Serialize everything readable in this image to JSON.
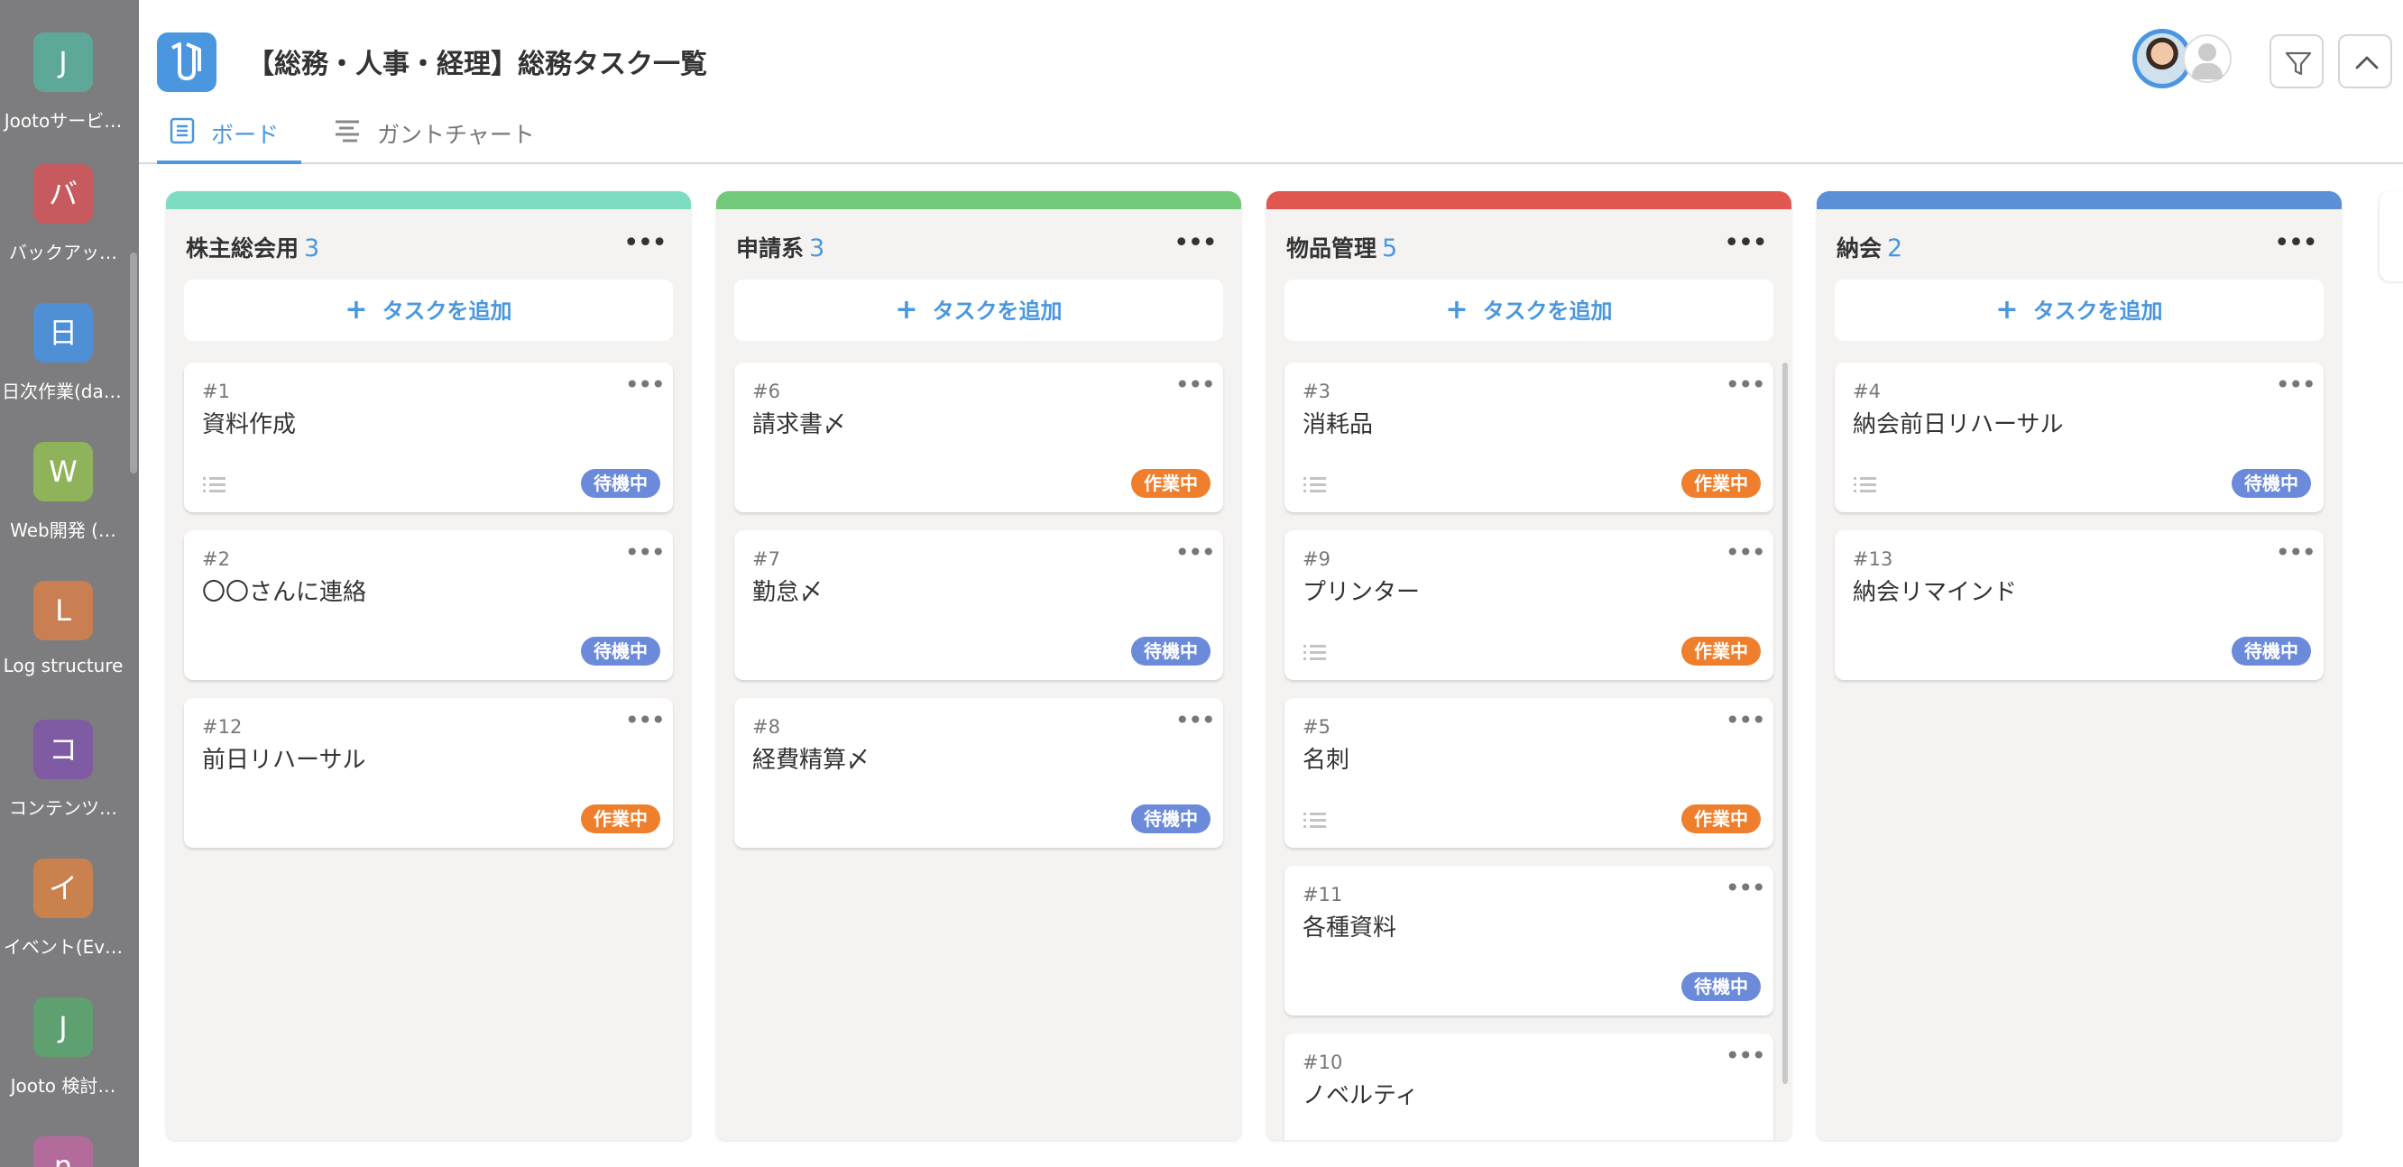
{
  "sidebar": {
    "items": [
      {
        "initial": "J",
        "label": "Jootoサービ…",
        "color": "#5ea89a"
      },
      {
        "initial": "バ",
        "label": "バックアッ…",
        "color": "#c65a5e"
      },
      {
        "initial": "日",
        "label": "日次作業(dai…",
        "color": "#4f8fd6"
      },
      {
        "initial": "W",
        "label": "Web開発 (…",
        "color": "#8fb35b"
      },
      {
        "initial": "L",
        "label": "Log structure",
        "color": "#c97f52"
      },
      {
        "initial": "コ",
        "label": "コンテンツ…",
        "color": "#7e5ba3"
      },
      {
        "initial": "イ",
        "label": "イベント(Ev…",
        "color": "#c9824e"
      },
      {
        "initial": "J",
        "label": "Jooto 検討…",
        "color": "#5ea06f"
      },
      {
        "initial": "n",
        "label": "",
        "color": "#b36b9c"
      }
    ]
  },
  "header": {
    "title": "【総務・人事・経理】総務タスク一覧",
    "tabs": [
      {
        "label": "ボード",
        "active": true,
        "icon": "board-icon"
      },
      {
        "label": "ガントチャート",
        "active": false,
        "icon": "gantt-icon"
      }
    ]
  },
  "labels": {
    "add_task": "タスクを追加",
    "add_plus": "+",
    "more": "•••"
  },
  "columns": [
    {
      "name": "株主総会用",
      "count": "3",
      "color": "#7dddc3",
      "cards": [
        {
          "num": "#1",
          "title": "資料作成",
          "status": "待機中",
          "status_type": "waiting",
          "list_icon": true
        },
        {
          "num": "#2",
          "title": "〇〇さんに連絡",
          "status": "待機中",
          "status_type": "waiting",
          "list_icon": false
        },
        {
          "num": "#12",
          "title": "前日リハーサル",
          "status": "作業中",
          "status_type": "working",
          "list_icon": false
        }
      ]
    },
    {
      "name": "申請系",
      "count": "3",
      "color": "#72c97a",
      "cards": [
        {
          "num": "#6",
          "title": "請求書〆",
          "status": "作業中",
          "status_type": "working",
          "list_icon": false
        },
        {
          "num": "#7",
          "title": "勤怠〆",
          "status": "待機中",
          "status_type": "waiting",
          "list_icon": false
        },
        {
          "num": "#8",
          "title": "経費精算〆",
          "status": "待機中",
          "status_type": "waiting",
          "list_icon": false
        }
      ]
    },
    {
      "name": "物品管理",
      "count": "5",
      "color": "#e0574f",
      "cards": [
        {
          "num": "#3",
          "title": "消耗品",
          "status": "作業中",
          "status_type": "working",
          "list_icon": true
        },
        {
          "num": "#9",
          "title": "プリンター",
          "status": "作業中",
          "status_type": "working",
          "list_icon": true
        },
        {
          "num": "#5",
          "title": "名刺",
          "status": "作業中",
          "status_type": "working",
          "list_icon": true
        },
        {
          "num": "#11",
          "title": "各種資料",
          "status": "待機中",
          "status_type": "waiting",
          "list_icon": false
        },
        {
          "num": "#10",
          "title": "ノベルティ",
          "status": "",
          "status_type": "",
          "list_icon": false
        }
      ]
    },
    {
      "name": "納会",
      "count": "2",
      "color": "#5b8fd6",
      "cards": [
        {
          "num": "#4",
          "title": "納会前日リハーサル",
          "status": "待機中",
          "status_type": "waiting",
          "list_icon": true
        },
        {
          "num": "#13",
          "title": "納会リマインド",
          "status": "待機中",
          "status_type": "waiting",
          "list_icon": false
        }
      ]
    }
  ]
}
